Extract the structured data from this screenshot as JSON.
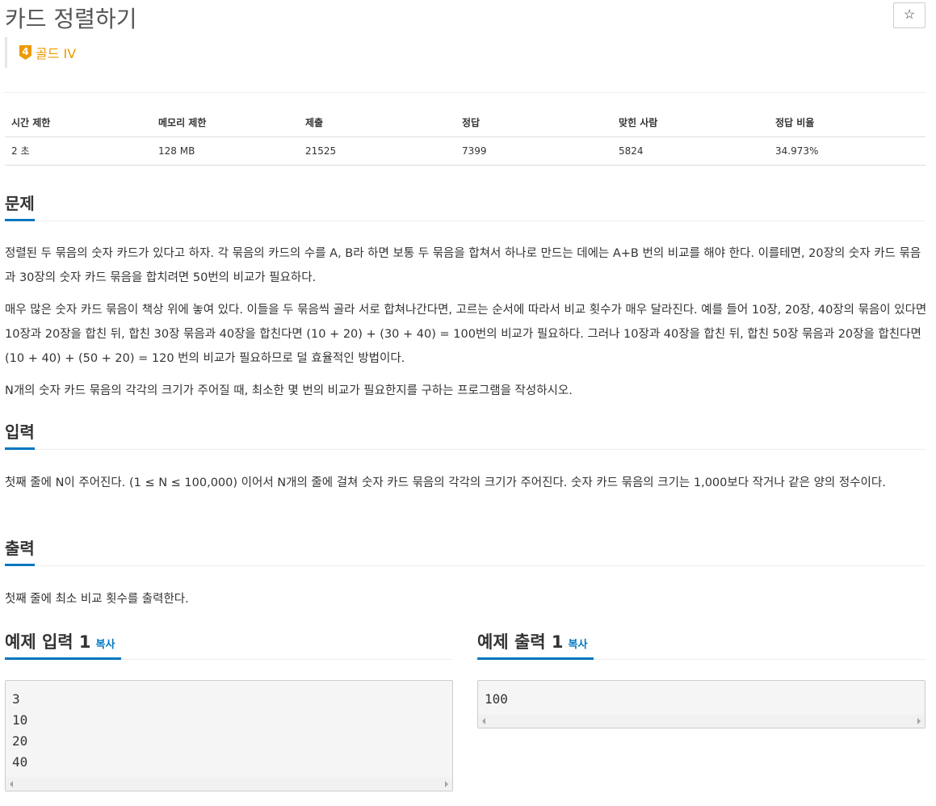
{
  "problem": {
    "title": "카드 정렬하기",
    "star_label": "☆",
    "tier_number": "4",
    "tier_label": "골드 IV",
    "tier_color": "#ec9a00"
  },
  "info_table": {
    "headers": [
      "시간 제한",
      "메모리 제한",
      "제출",
      "정답",
      "맞힌 사람",
      "정답 비율"
    ],
    "values": [
      "2 초",
      "128 MB",
      "21525",
      "7399",
      "5824",
      "34.973%"
    ]
  },
  "sections": {
    "problem": {
      "heading": "문제",
      "paragraphs": [
        "정렬된 두 묶음의 숫자 카드가 있다고 하자. 각 묶음의 카드의 수를 A, B라 하면 보통 두 묶음을 합쳐서 하나로 만드는 데에는 A+B 번의 비교를 해야 한다. 이를테면, 20장의 숫자 카드 묶음과 30장의 숫자 카드 묶음을 합치려면 50번의 비교가 필요하다.",
        "매우 많은 숫자 카드 묶음이 책상 위에 놓여 있다. 이들을 두 묶음씩 골라 서로 합쳐나간다면, 고르는 순서에 따라서 비교 횟수가 매우 달라진다. 예를 들어 10장, 20장, 40장의 묶음이 있다면 10장과 20장을 합친 뒤, 합친 30장 묶음과 40장을 합친다면 (10 + 20) + (30 + 40) = 100번의 비교가 필요하다. 그러나 10장과 40장을 합친 뒤, 합친 50장 묶음과 20장을 합친다면 (10 + 40) + (50 + 20) = 120 번의 비교가 필요하므로 덜 효율적인 방법이다.",
        "N개의 숫자 카드 묶음의 각각의 크기가 주어질 때, 최소한 몇 번의 비교가 필요한지를 구하는 프로그램을 작성하시오."
      ]
    },
    "input": {
      "heading": "입력",
      "paragraphs": [
        "첫째 줄에 N이 주어진다. (1 ≤ N ≤ 100,000) 이어서 N개의 줄에 걸쳐 숫자 카드 묶음의 각각의 크기가 주어진다. 숫자 카드 묶음의 크기는 1,000보다 작거나 같은 양의 정수이다."
      ]
    },
    "output": {
      "heading": "출력",
      "paragraphs": [
        "첫째 줄에 최소 비교 횟수를 출력한다."
      ]
    }
  },
  "samples": {
    "input": {
      "heading": "예제 입력 1",
      "copy_label": "복사",
      "lines": [
        "3",
        "10",
        "20",
        "40"
      ]
    },
    "output": {
      "heading": "예제 출력 1",
      "copy_label": "복사",
      "lines": [
        "100"
      ]
    }
  },
  "colors": {
    "accent": "#0076c0",
    "tier": "#ec9a00",
    "text": "#333333"
  }
}
